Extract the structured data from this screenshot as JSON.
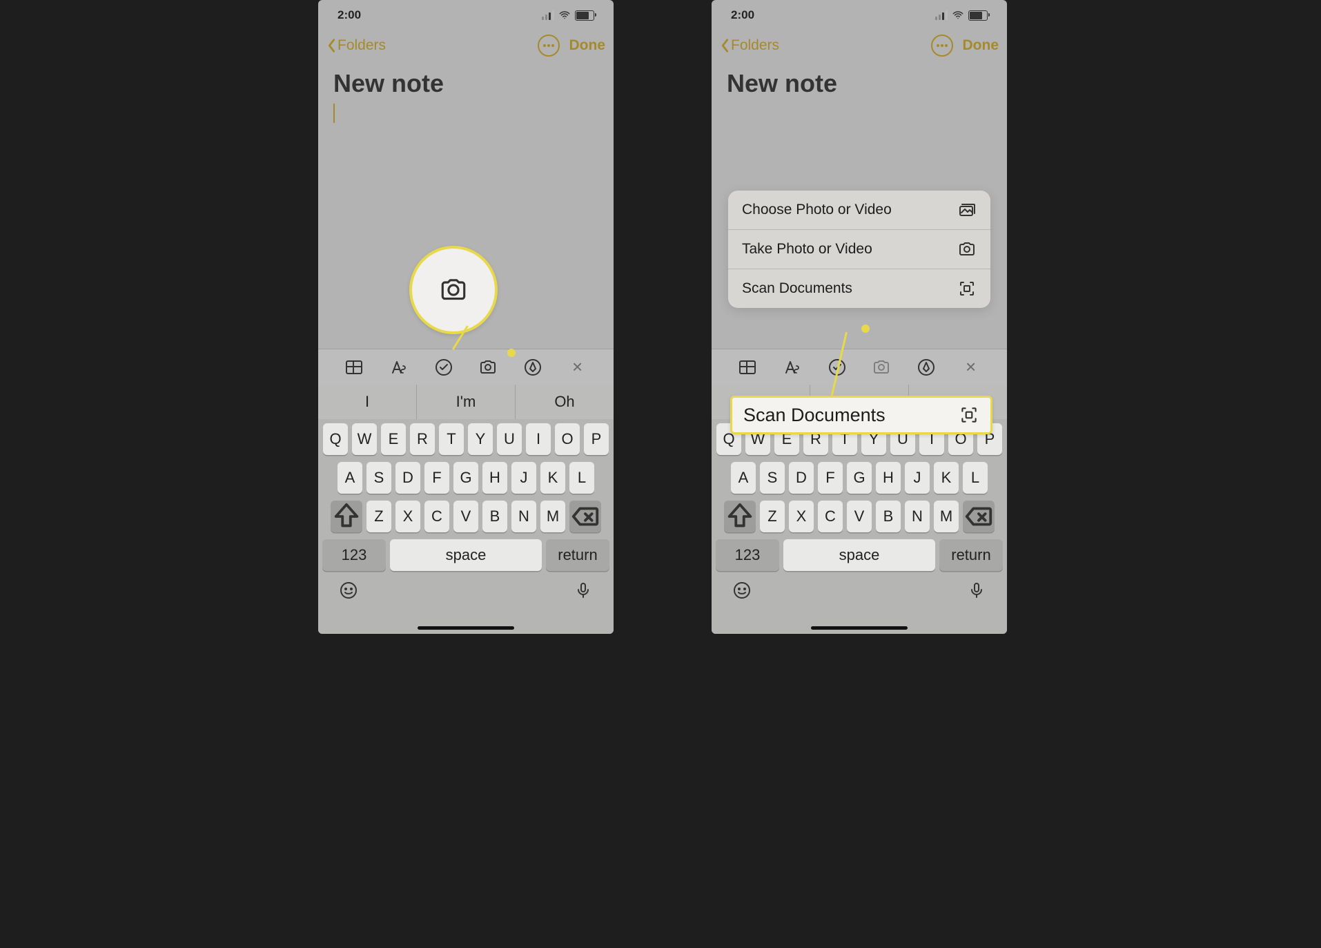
{
  "status": {
    "time": "2:00"
  },
  "nav": {
    "back": "Folders",
    "done": "Done"
  },
  "note": {
    "title": "New note"
  },
  "suggestions": [
    "I",
    "I'm",
    "Oh"
  ],
  "keyboard": {
    "row1": [
      "Q",
      "W",
      "E",
      "R",
      "T",
      "Y",
      "U",
      "I",
      "O",
      "P"
    ],
    "row2": [
      "A",
      "S",
      "D",
      "F",
      "G",
      "H",
      "J",
      "K",
      "L"
    ],
    "row3": [
      "Z",
      "X",
      "C",
      "V",
      "B",
      "N",
      "M"
    ],
    "numKey": "123",
    "space": "space",
    "ret": "return"
  },
  "menu": {
    "choose": "Choose Photo or Video",
    "take": "Take Photo or Video",
    "scan": "Scan Documents"
  },
  "callout": {
    "scan": "Scan Documents"
  }
}
